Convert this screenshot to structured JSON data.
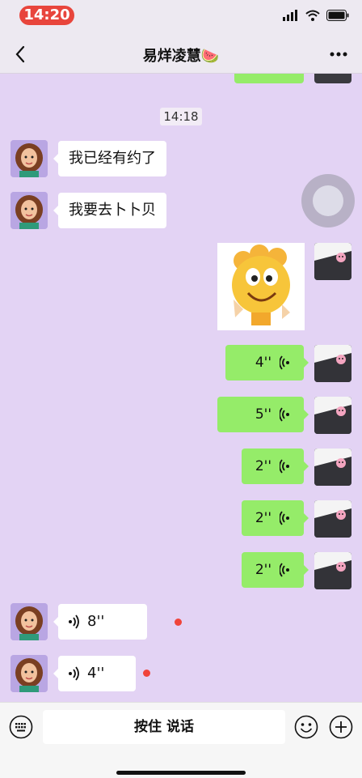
{
  "status": {
    "time": "14:20"
  },
  "header": {
    "title": "易烊凌慧🍉"
  },
  "chat": {
    "timestamp": "14:18",
    "msg1": "我已经有约了",
    "msg2": "我要去卜卜贝",
    "voice_sent": [
      "4''",
      "5''",
      "2''",
      "2''",
      "2''"
    ],
    "voice_recv": [
      "8''",
      "4''"
    ]
  },
  "input": {
    "hold_to_talk": "按住 说话"
  },
  "colors": {
    "sent_bubble": "#95ec69",
    "background": "#e3d3f4",
    "unread_dot": "#f0443a"
  }
}
